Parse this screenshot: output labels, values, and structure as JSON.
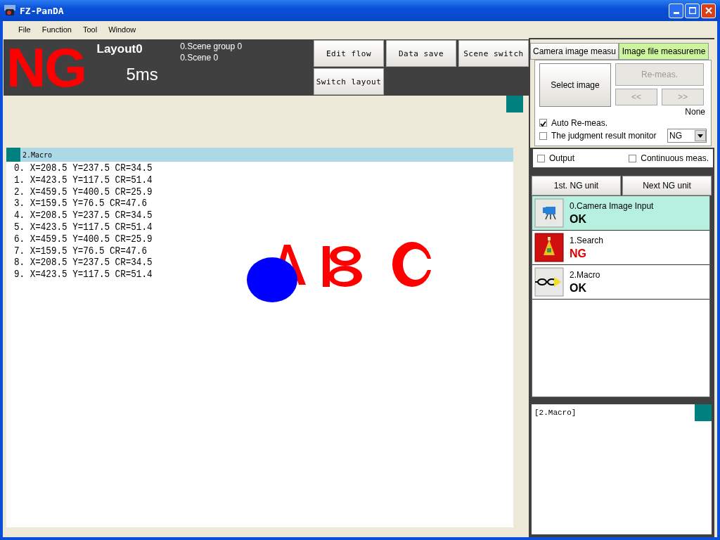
{
  "window": {
    "title": "FZ-PanDA"
  },
  "menu": [
    "File",
    "Function",
    "Tool",
    "Window"
  ],
  "status": {
    "judgment": "NG",
    "ok": false,
    "layout": "Layout0",
    "time": "5ms",
    "scene_group": "0.Scene group 0",
    "scene": "0.Scene 0"
  },
  "toolbar": [
    "Edit flow",
    "Data save",
    "Scene switch",
    "Switch layout"
  ],
  "image_window": {
    "title": "2.Macro",
    "lines": [
      "0. X=208.5 Y=237.5 CR=34.5",
      "1. X=423.5 Y=117.5 CR=51.4",
      "2. X=459.5 Y=400.5 CR=25.9",
      "3. X=159.5 Y=76.5 CR=47.6",
      "4. X=208.5 Y=237.5 CR=34.5",
      "5. X=423.5 Y=117.5 CR=51.4",
      "6. X=459.5 Y=400.5 CR=25.9",
      "7. X=159.5 Y=76.5 CR=47.6",
      "8. X=208.5 Y=237.5 CR=34.5",
      "9. X=423.5 Y=117.5 CR=51.4"
    ]
  },
  "tabs": [
    {
      "label": "Camera image measu",
      "selected": false
    },
    {
      "label": "Image file measureme",
      "selected": true
    }
  ],
  "image_file": {
    "select_button": "Select image",
    "remeas_button": {
      "label": "Re-meas.",
      "disabled": true
    },
    "prev_button": {
      "label": "<<",
      "disabled": true
    },
    "next_button": {
      "label": ">>",
      "disabled": true
    },
    "file_name": "None",
    "auto_remeas": {
      "label": "Auto Re-meas.",
      "checked": true
    },
    "judgment_monitor": {
      "label": "The judgment result monitor",
      "checked": false,
      "value": "NG"
    }
  },
  "output": {
    "label": "Output",
    "checked": false
  },
  "continuous": {
    "label": "Continuous meas.",
    "checked": false
  },
  "ng_buttons": [
    "1st. NG unit",
    "Next NG unit"
  ],
  "units": [
    {
      "kind": "camera",
      "name": "0.Camera Image Input",
      "result": "OK",
      "ok": true,
      "selected": true
    },
    {
      "kind": "search",
      "name": "1.Search",
      "result": "NG",
      "ok": false,
      "selected": false
    },
    {
      "kind": "macro",
      "name": "2.Macro",
      "result": "OK",
      "ok": true,
      "selected": false
    }
  ],
  "detail": {
    "title": "[2.Macro]"
  }
}
